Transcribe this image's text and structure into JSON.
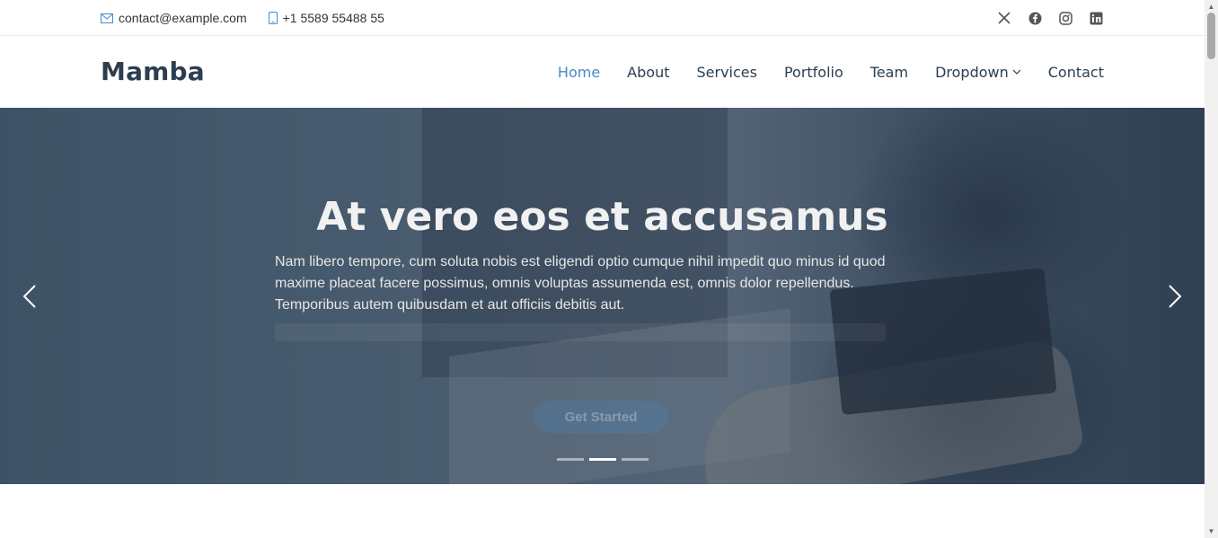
{
  "topbar": {
    "email": "contact@example.com",
    "phone": "+1 5589 55488 55",
    "social": [
      "x-icon",
      "facebook-icon",
      "instagram-icon",
      "linkedin-icon"
    ]
  },
  "header": {
    "logo": "Mamba",
    "nav": [
      "Home",
      "About",
      "Services",
      "Portfolio",
      "Team",
      "Dropdown",
      "Contact"
    ],
    "active": "Home"
  },
  "hero": {
    "title": "At vero eos et accusamus",
    "text": "Nam libero tempore, cum soluta nobis est eligendi optio cumque nihil impedit quo minus id quod maxime placeat facere possimus, omnis voluptas assumenda est, omnis dolor repellendus. Temporibus autem quibusdam et aut officiis debitis aut.",
    "cta": "Get Started",
    "slides": 3,
    "active_slide": 2
  },
  "colors": {
    "accent": "#428bca",
    "text": "#2c3e50"
  }
}
